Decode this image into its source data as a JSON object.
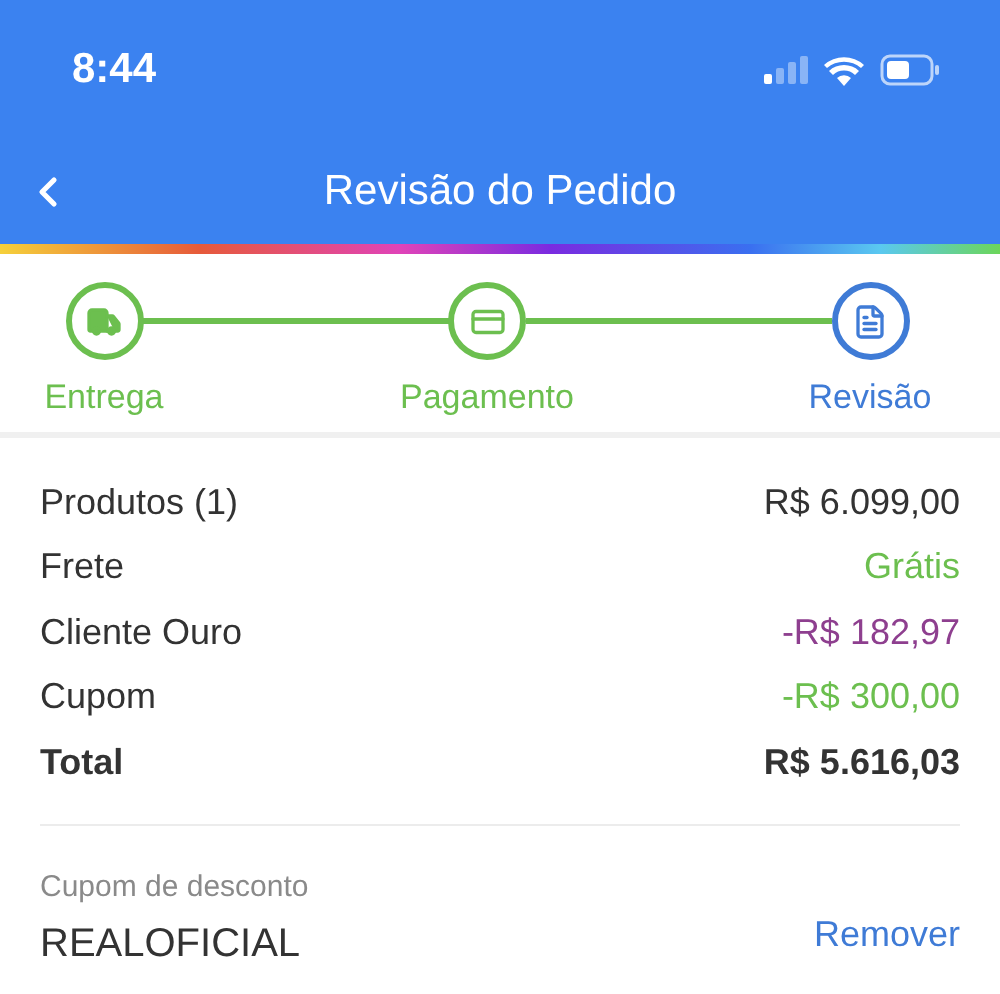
{
  "status_bar": {
    "time": "8:44"
  },
  "nav": {
    "title": "Revisão do Pedido"
  },
  "steps": [
    {
      "label": "Entrega",
      "kind": "truck",
      "current": false
    },
    {
      "label": "Pagamento",
      "kind": "card",
      "current": false
    },
    {
      "label": "Revisão",
      "kind": "receipt",
      "current": true
    }
  ],
  "summary": [
    {
      "label": "Produtos (1)",
      "value": "R$ 6.099,00",
      "color": "#333333",
      "kind": "line"
    },
    {
      "label": "Frete",
      "value": "Grátis",
      "color": "#6cbf4f",
      "kind": "line"
    },
    {
      "label": "Cliente Ouro",
      "value": "-R$ 182,97",
      "color": "#8e3f8f",
      "kind": "line"
    },
    {
      "label": "Cupom",
      "value": "-R$ 300,00",
      "color": "#6cbf4f",
      "kind": "line"
    },
    {
      "label": "Total",
      "value": "R$ 5.616,03",
      "color": "#333333",
      "kind": "total"
    }
  ],
  "coupon": {
    "label": "Cupom de desconto",
    "code": "REALOFICIAL",
    "action": "Remover"
  }
}
